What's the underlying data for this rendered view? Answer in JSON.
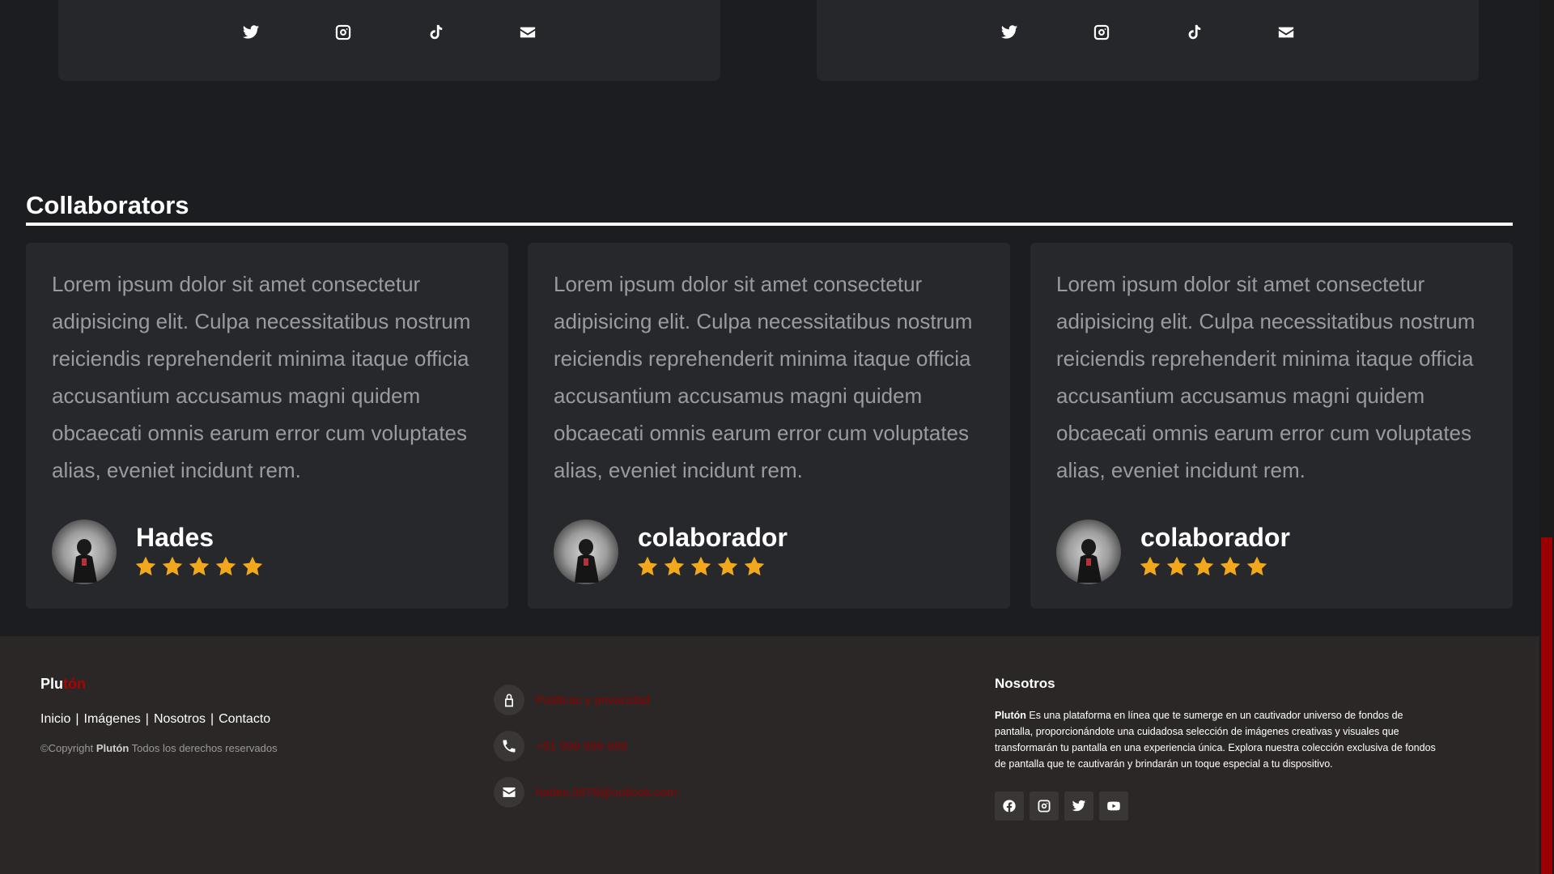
{
  "team_socials": [
    "twitter-icon",
    "instagram-icon",
    "tiktok-icon",
    "mail-icon"
  ],
  "collaborators": {
    "title": "Collaborators",
    "cards": [
      {
        "text": "Lorem ipsum dolor sit amet consectetur adipisicing elit. Culpa necessitatibus nostrum reiciendis reprehenderit minima itaque officia accusantium accusamus magni quidem obcaecati omnis earum error cum voluptates alias, eveniet incidunt rem.",
        "name": "Hades",
        "rating": 5
      },
      {
        "text": "Lorem ipsum dolor sit amet consectetur adipisicing elit. Culpa necessitatibus nostrum reiciendis reprehenderit minima itaque officia accusantium accusamus magni quidem obcaecati omnis earum error cum voluptates alias, eveniet incidunt rem.",
        "name": "colaborador",
        "rating": 5
      },
      {
        "text": "Lorem ipsum dolor sit amet consectetur adipisicing elit. Culpa necessitatibus nostrum reiciendis reprehenderit minima itaque officia accusantium accusamus magni quidem obcaecati omnis earum error cum voluptates alias, eveniet incidunt rem.",
        "name": "colaborador",
        "rating": 5
      }
    ]
  },
  "footer": {
    "brand": {
      "part1": "Plu",
      "part2": "tón"
    },
    "nav": [
      "Inicio",
      "Imágenes",
      "Nosotros",
      "Contacto"
    ],
    "nav_separator": "|",
    "copyright": {
      "prefix": "©Copyright",
      "brand": "Plutón",
      "suffix": "Todos los derechos reservados"
    },
    "contact": [
      {
        "icon": "lock-icon",
        "text": "Políticas y privacidad"
      },
      {
        "icon": "phone-icon",
        "text": "+51 999 999 999"
      },
      {
        "icon": "mail-icon",
        "text": "hades.5678@outlook.com"
      }
    ],
    "about": {
      "title": "Nosotros",
      "brand": "Plutón",
      "text": "Es una plataforma en línea que te sumerge en un cautivador universo de fondos de pantalla, proporcionándote una cuidadosa selección de imágenes creativas y visuales que transformarán tu pantalla en una experiencia única. Explora nuestra colección exclusiva de fondos de pantalla que te cautivarán y brindarán un toque especial a tu dispositivo."
    },
    "about_socials": [
      "facebook-icon",
      "instagram-icon",
      "twitter-icon",
      "youtube-icon"
    ]
  },
  "colors": {
    "accent": "#b00000",
    "star": "#f2a81d",
    "background": "#1c1d20",
    "footer": "#2b2727"
  }
}
